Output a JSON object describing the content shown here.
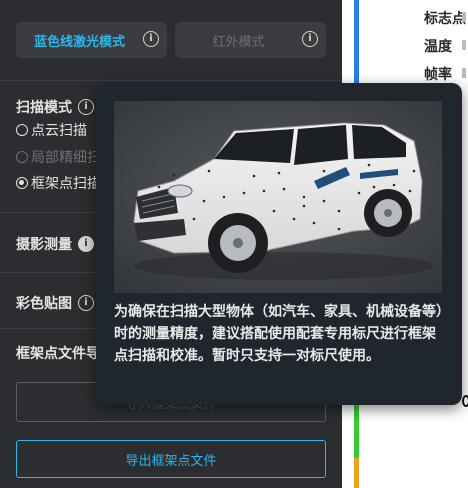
{
  "modes": {
    "blue_laser_label": "蓝色线激光模式",
    "infrared_label": "红外模式"
  },
  "scan_mode": {
    "title": "扫描模式",
    "options": [
      {
        "label": "点云扫描",
        "selected": false,
        "disabled": false
      },
      {
        "label": "局部精细扫描",
        "selected": false,
        "disabled": true
      },
      {
        "label": "框架点扫描",
        "selected": true,
        "disabled": false
      }
    ]
  },
  "photogrammetry": {
    "title": "摄影测量"
  },
  "color_texture": {
    "title": "彩色贴图"
  },
  "frame_file": {
    "title": "框架点文件导入",
    "import_label": "导入框架点文件",
    "export_label": "导出框架点文件"
  },
  "stats": {
    "labels": [
      "标志点",
      "温度",
      "帧率"
    ]
  },
  "side_bar_colors": {
    "blue": "#2a7de1",
    "green": "#33cc33",
    "orange": "#f0a020"
  },
  "accent_color": "#2bb7ea",
  "tooltip": {
    "image_alt": "扫描的白色吉普车（贴有标志点和标尺）",
    "text": "为确保在扫描大型物体（如汽车、家具、机械设备等）时的测量精度，建议搭配使用配套专用标尺进行框架点扫描和校准。暂时只支持一对标尺使用。"
  }
}
